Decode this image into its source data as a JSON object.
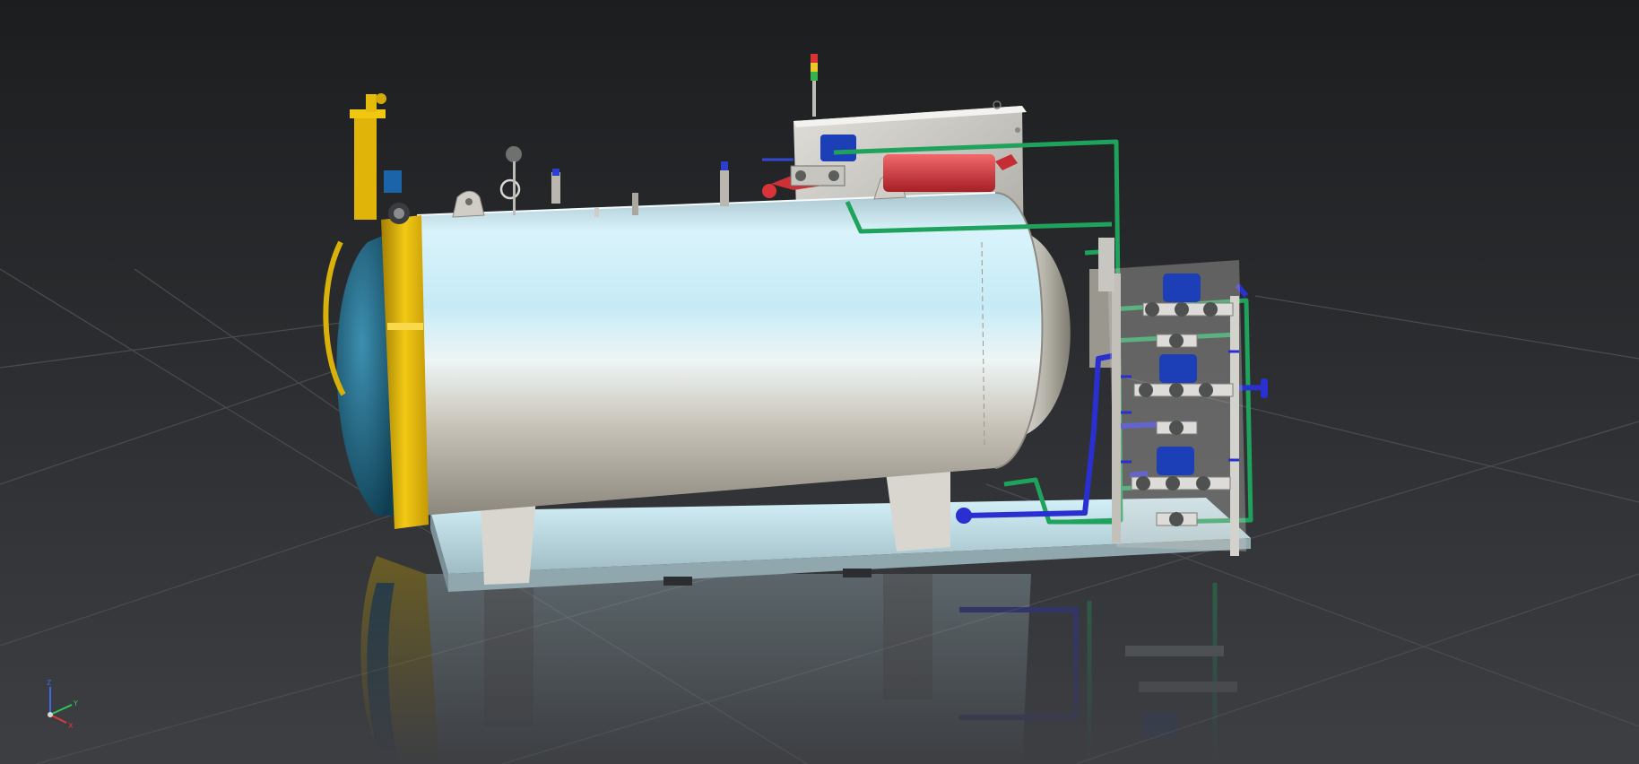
{
  "viewport": {
    "background_top": "#1c1d1f",
    "background_bottom": "#3d3f43",
    "grid_color": "#4a4c50"
  },
  "model": {
    "vessel_color": "#c9e9f3",
    "door_color": "#e3b908",
    "door_glass_color": "#1d5f7a",
    "steam_pipe_color": "#1fa35c",
    "water_pipe_color": "#2a2fd0",
    "heater_color": "#d9343a",
    "actuator_color": "#1c3fb8",
    "frame_color": "#c8c6c0"
  },
  "axis_triad": {
    "x_label": "X",
    "y_label": "Y",
    "z_label": "Z",
    "x_color": "#e5363a",
    "y_color": "#2ec75a",
    "z_color": "#3d6ae0"
  }
}
